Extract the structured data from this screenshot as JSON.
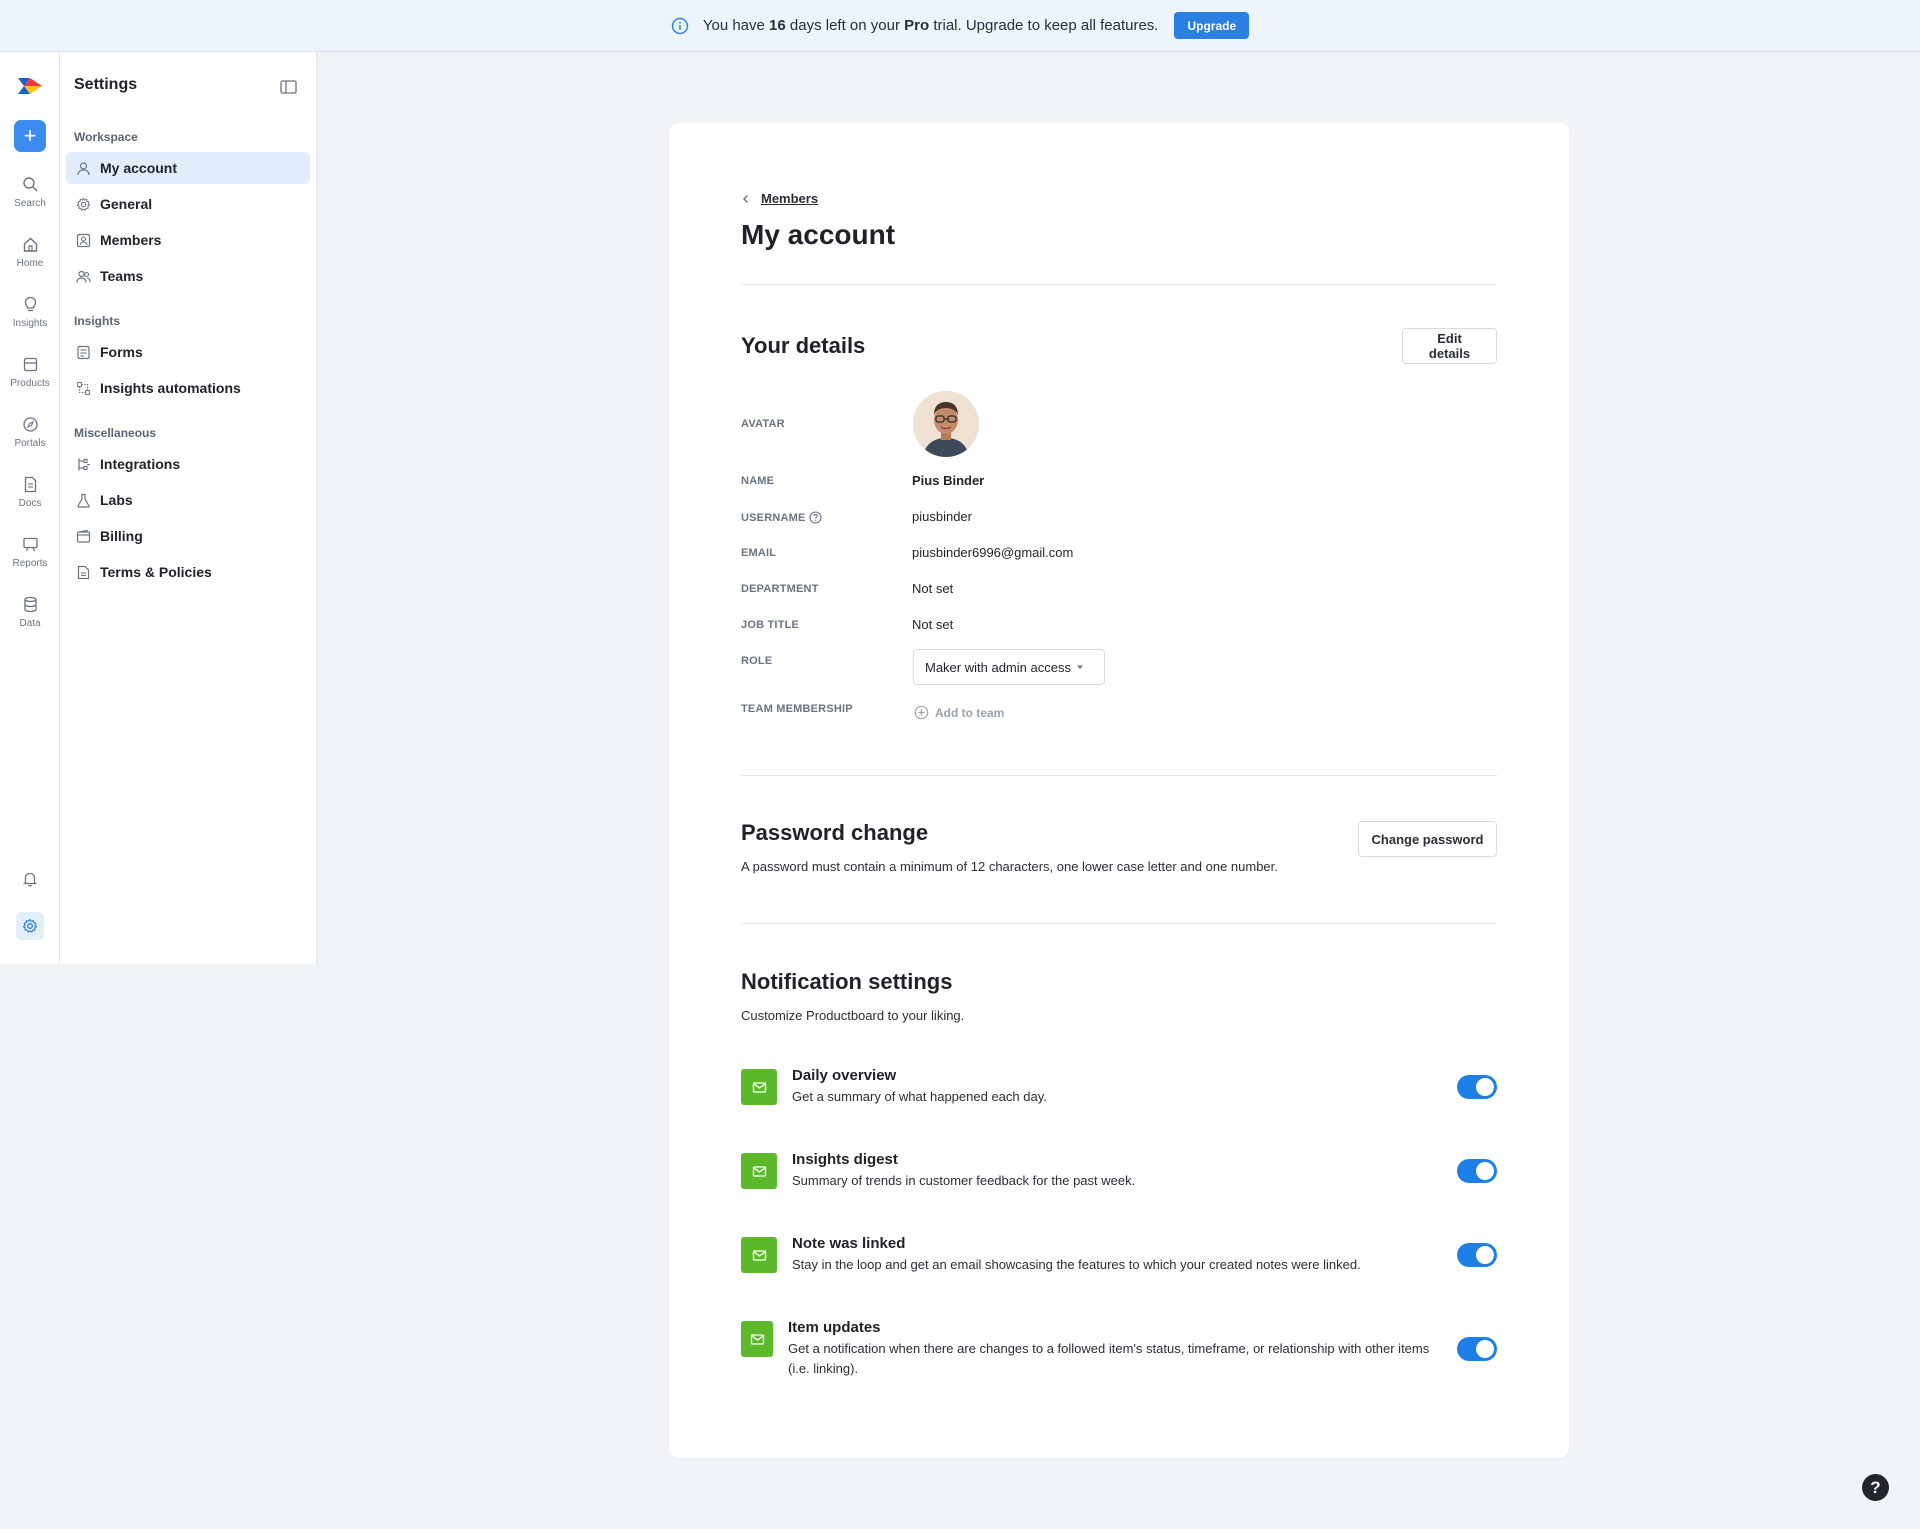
{
  "banner": {
    "text_before": "You have",
    "days": "16",
    "text_mid": "days left on your",
    "plan": "Pro",
    "text_after": "trial. Upgrade to keep all features.",
    "upgrade_label": "Upgrade"
  },
  "rail": {
    "items": [
      {
        "label": "Search",
        "icon": "search-icon"
      },
      {
        "label": "Home",
        "icon": "home-icon"
      },
      {
        "label": "Insights",
        "icon": "lightbulb-icon"
      },
      {
        "label": "Products",
        "icon": "products-icon"
      },
      {
        "label": "Portals",
        "icon": "compass-icon"
      },
      {
        "label": "Docs",
        "icon": "doc-icon"
      },
      {
        "label": "Reports",
        "icon": "presentation-icon"
      },
      {
        "label": "Data",
        "icon": "database-icon"
      }
    ]
  },
  "sidebar": {
    "title": "Settings",
    "workspace_label": "Workspace",
    "insights_label": "Insights",
    "misc_label": "Miscellaneous",
    "items": [
      {
        "label": "My account"
      },
      {
        "label": "General"
      },
      {
        "label": "Members"
      },
      {
        "label": "Teams"
      },
      {
        "label": "Forms"
      },
      {
        "label": "Insights automations"
      },
      {
        "label": "Integrations"
      },
      {
        "label": "Labs"
      },
      {
        "label": "Billing"
      },
      {
        "label": "Terms & Policies"
      }
    ]
  },
  "main": {
    "breadcrumb": "Members",
    "title": "My account",
    "details": {
      "title": "Your details",
      "edit_label": "Edit details",
      "avatar_label": "AVATAR",
      "name_label": "NAME",
      "name": "Pius Binder",
      "username_label": "USERNAME",
      "username": "piusbinder",
      "email_label": "EMAIL",
      "email": "piusbinder6996@gmail.com",
      "department_label": "DEPARTMENT",
      "department": "Not set",
      "job_label": "JOB TITLE",
      "job": "Not set",
      "role_label": "ROLE",
      "role": "Maker with admin access",
      "team_label": "TEAM MEMBERSHIP",
      "add_team": "Add to team"
    },
    "password": {
      "title": "Password change",
      "button": "Change password",
      "description": "A password must contain a minimum of 12 characters, one lower case letter and one number."
    },
    "notifications": {
      "title": "Notification settings",
      "description": "Customize Productboard to your liking.",
      "items": [
        {
          "title": "Daily overview",
          "description": "Get a summary of what happened each day.",
          "enabled": true
        },
        {
          "title": "Insights digest",
          "description": "Summary of trends in customer feedback for the past week.",
          "enabled": true
        },
        {
          "title": "Note was linked",
          "description": "Stay in the loop and get an email showcasing the features to which your created notes were linked.",
          "enabled": true
        },
        {
          "title": "Item updates",
          "description": "Get a notification when there are changes to a followed item's status, timeframe, or relationship with other items (i.e. linking).",
          "enabled": true
        }
      ]
    }
  },
  "help_label": "?",
  "colors": {
    "accent": "#2b7fe0",
    "toggle_on": "#1e7fe6",
    "email_icon_bg": "#5db92c",
    "active_nav": "#e1edfb"
  }
}
